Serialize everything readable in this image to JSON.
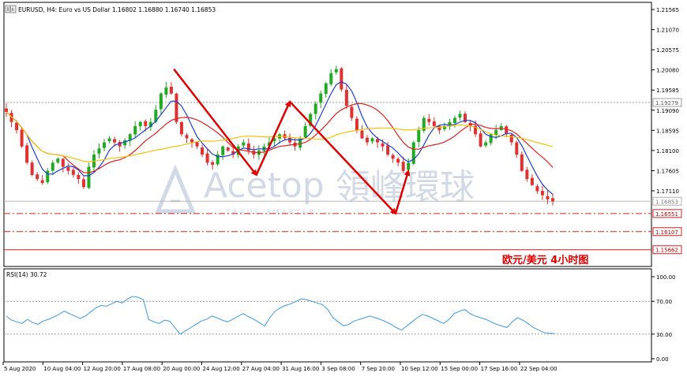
{
  "header": {
    "symbol_line": "EURUSD, H4:  Euro vs US Dollar  1.16802 1.16880 1.16740 1.16853"
  },
  "watermark": {
    "brand": "Acetop",
    "chinese": "領峰環球",
    "tagline": "TRADE SMARTER"
  },
  "annotation": {
    "caption": "欧元/美元    4小时图"
  },
  "colors": {
    "up_candle": "#22aa22",
    "down_candle": "#e03030",
    "ma_fast": "#1f3fd8",
    "ma_mid": "#e02020",
    "ma_slow": "#f5c20a",
    "rsi_line": "#3b9ae0",
    "arrow": "#e00000",
    "support_dashdot": "#d62020",
    "support_solid": "#d62020",
    "price_level_gray": "#9a9a9a",
    "grid": "#000000"
  },
  "chart_data": [
    {
      "type": "candlestick",
      "title": "EURUSD, H4",
      "price_axis_ticks": [
        "1.21565",
        "1.21070",
        "1.20575",
        "1.20080",
        "1.19585",
        "1.19090",
        "1.18595",
        "1.18100",
        "1.17605",
        "1.17110"
      ],
      "ylim": [
        1.1525,
        1.2174
      ],
      "x_tick_labels": [
        "5 Aug 2020",
        "10 Aug 04:00",
        "12 Aug 20:00",
        "17 Aug 08:00",
        "20 Aug 00:00",
        "24 Aug 12:00",
        "27 Aug 04:00",
        "31 Aug 16:00",
        "3 Sep 08:00",
        "7 Sep 20:00",
        "10 Sep 12:00",
        "15 Sep 00:00",
        "17 Sep 16:00",
        "22 Sep 04:00"
      ],
      "price_labels": [
        {
          "label": "1.19279",
          "value": 1.19279,
          "style": "gray"
        },
        {
          "label": "1.16853",
          "value": 1.16853,
          "style": "current"
        },
        {
          "label": "1.16551",
          "value": 1.16551,
          "style": "red-dashdot"
        },
        {
          "label": "1.16107",
          "value": 1.16107,
          "style": "red-dashdot"
        },
        {
          "label": "1.15662",
          "value": 1.15662,
          "style": "red-solid"
        }
      ],
      "close_path": [
        1.1905,
        1.188,
        1.186,
        1.182,
        1.178,
        1.175,
        1.174,
        1.173,
        1.176,
        1.178,
        1.179,
        1.177,
        1.176,
        1.175,
        1.174,
        1.172,
        1.177,
        1.18,
        1.1815,
        1.183,
        1.184,
        1.183,
        1.182,
        1.1835,
        1.185,
        1.187,
        1.188,
        1.187,
        1.188,
        1.191,
        1.195,
        1.1965,
        1.195,
        1.188,
        1.185,
        1.184,
        1.183,
        1.182,
        1.18,
        1.178,
        1.1775,
        1.18,
        1.182,
        1.181,
        1.18,
        1.182,
        1.183,
        1.181,
        1.18,
        1.181,
        1.182,
        1.183,
        1.184,
        1.185,
        1.184,
        1.183,
        1.182,
        1.184,
        1.187,
        1.19,
        1.1925,
        1.195,
        1.1975,
        1.2,
        1.201,
        1.196,
        1.192,
        1.189,
        1.186,
        1.184,
        1.183,
        1.184,
        1.183,
        1.182,
        1.18,
        1.179,
        1.178,
        1.176,
        1.178,
        1.183,
        1.186,
        1.189,
        1.188,
        1.187,
        1.186,
        1.187,
        1.188,
        1.189,
        1.19,
        1.188,
        1.187,
        1.185,
        1.182,
        1.183,
        1.185,
        1.186,
        1.187,
        1.185,
        1.183,
        1.18,
        1.176,
        1.174,
        1.1725,
        1.171,
        1.17,
        1.169,
        1.1685
      ],
      "series": [
        {
          "name": "",
          "kind": "moving-average",
          "color_key": "ma_fast"
        },
        {
          "name": "",
          "kind": "moving-average",
          "color_key": "ma_mid"
        },
        {
          "name": "",
          "kind": "moving-average",
          "color_key": "ma_slow"
        }
      ],
      "arrows": [
        {
          "from": [
            32.5,
            1.201
          ],
          "to": [
            48.5,
            1.175
          ]
        },
        {
          "from": [
            48.5,
            1.175
          ],
          "to": [
            55,
            1.193
          ]
        },
        {
          "from": [
            55,
            1.193
          ],
          "to": [
            75.5,
            1.1655
          ]
        },
        {
          "from": [
            75.5,
            1.1655
          ],
          "to": [
            78,
            1.176
          ]
        }
      ]
    },
    {
      "type": "line",
      "title": "RSI(14) 30.72",
      "ylim": [
        0,
        100
      ],
      "y_ticks": [
        "100.00",
        "70.00",
        "30.00",
        "0.00"
      ],
      "reference_levels": [
        70,
        30
      ],
      "values": [
        52,
        47,
        45,
        43,
        48,
        44,
        42,
        46,
        48,
        51,
        54,
        58,
        55,
        52,
        49,
        52,
        57,
        62,
        65,
        64,
        67,
        70,
        68,
        73,
        76,
        75,
        72,
        48,
        45,
        43,
        47,
        46,
        38,
        30,
        34,
        38,
        42,
        46,
        48,
        52,
        50,
        47,
        45,
        48,
        52,
        55,
        51,
        48,
        44,
        40,
        50,
        58,
        62,
        65,
        67,
        70,
        73,
        72,
        70,
        68,
        66,
        60,
        50,
        45,
        40,
        42,
        46,
        48,
        50,
        52,
        50,
        48,
        45,
        42,
        38,
        35,
        40,
        45,
        50,
        54,
        52,
        49,
        46,
        43,
        48,
        55,
        58,
        60,
        55,
        52,
        50,
        48,
        45,
        42,
        40,
        38,
        45,
        50,
        47,
        43,
        38,
        35,
        32,
        31,
        30.72
      ]
    }
  ]
}
